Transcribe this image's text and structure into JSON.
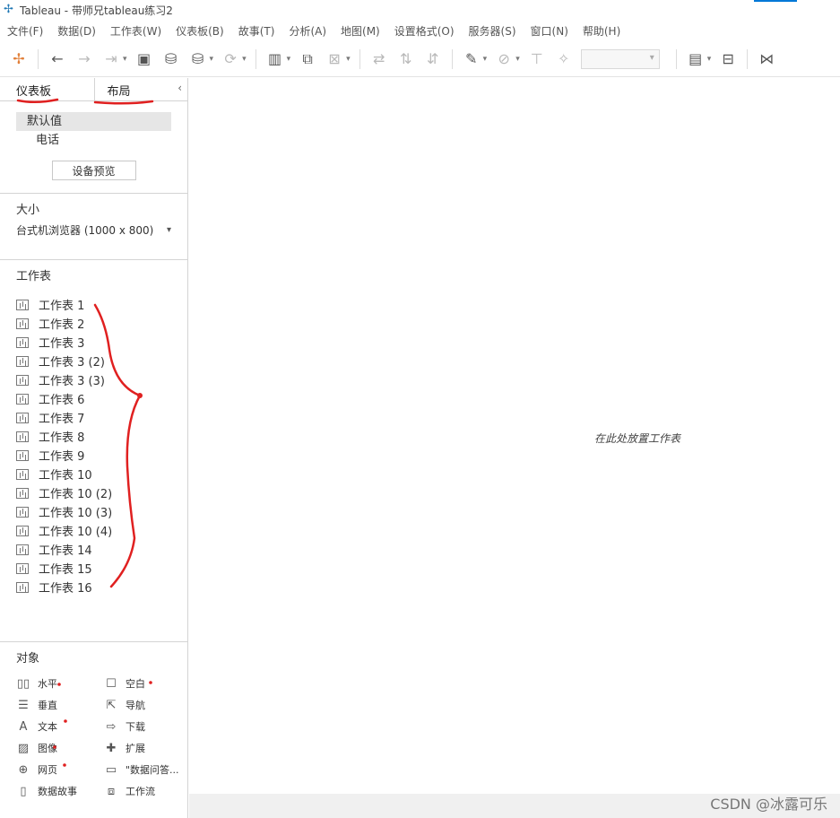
{
  "window": {
    "title": "Tableau - 带师兄tableau练习2",
    "watermark": "CSDN @冰露可乐"
  },
  "menu": [
    "文件(F)",
    "数据(D)",
    "工作表(W)",
    "仪表板(B)",
    "故事(T)",
    "分析(A)",
    "地图(M)",
    "设置格式(O)",
    "服务器(S)",
    "窗口(N)",
    "帮助(H)"
  ],
  "toolbar": {
    "icons": [
      "tableau-logo-icon",
      "undo-icon",
      "redo-icon",
      "replay-icon",
      "save-icon",
      "new-datasource-icon",
      "pause-updates-icon",
      "refresh-icon",
      "new-worksheet-icon",
      "duplicate-icon",
      "clear-icon",
      "swap-icon",
      "sort-ascending-icon",
      "sort-descending-icon",
      "highlight-icon",
      "group-icon",
      "labels-icon",
      "pin-icon",
      "fit-dropdown",
      "show-me-icon",
      "presentation-icon",
      "share-icon"
    ]
  },
  "sidebar": {
    "tabs": {
      "dashboard": "仪表板",
      "layout": "布局"
    },
    "devices": {
      "default": "默认值",
      "phone": "电话",
      "preview_button": "设备预览"
    },
    "size": {
      "title": "大小",
      "value": "台式机浏览器 (1000 x 800)"
    },
    "sheets": {
      "title": "工作表",
      "items": [
        "工作表 1",
        "工作表 2",
        "工作表 3",
        "工作表 3 (2)",
        "工作表 3 (3)",
        "工作表 6",
        "工作表 7",
        "工作表 8",
        "工作表 9",
        "工作表 10",
        "工作表 10 (2)",
        "工作表 10 (3)",
        "工作表 10 (4)",
        "工作表 14",
        "工作表 15",
        "工作表 16"
      ]
    },
    "objects": {
      "title": "对象",
      "items": [
        {
          "label": "水平",
          "icon": "horizontal-container-icon"
        },
        {
          "label": "空白",
          "icon": "blank-icon"
        },
        {
          "label": "垂直",
          "icon": "vertical-container-icon"
        },
        {
          "label": "导航",
          "icon": "navigation-icon"
        },
        {
          "label": "文本",
          "icon": "text-icon"
        },
        {
          "label": "下载",
          "icon": "download-icon"
        },
        {
          "label": "图像",
          "icon": "image-icon"
        },
        {
          "label": "扩展",
          "icon": "extension-icon"
        },
        {
          "label": "网页",
          "icon": "web-page-icon"
        },
        {
          "label": "\"数据问答...",
          "icon": "ask-data-icon"
        },
        {
          "label": "数据故事",
          "icon": "data-story-icon"
        },
        {
          "label": "工作流",
          "icon": "workflow-icon"
        }
      ]
    }
  },
  "canvas": {
    "hint": "在此处放置工作表"
  },
  "colors": {
    "annotation": "#e02020",
    "accent": "#0078d7"
  }
}
